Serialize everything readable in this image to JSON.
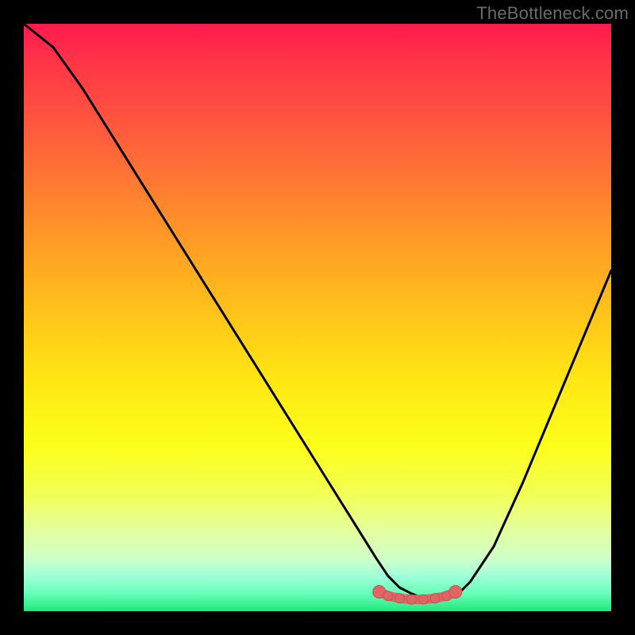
{
  "watermark": "TheBottleneck.com",
  "chart_data": {
    "type": "line",
    "title": "",
    "xlabel": "",
    "ylabel": "",
    "xlim": [
      0,
      100
    ],
    "ylim": [
      0,
      100
    ],
    "grid": false,
    "legend": false,
    "series": [
      {
        "name": "bottleneck-curve",
        "x": [
          0,
          5,
          10,
          15,
          20,
          25,
          30,
          35,
          40,
          45,
          50,
          55,
          60,
          62,
          64,
          66,
          68,
          70,
          72,
          74,
          76,
          80,
          85,
          90,
          95,
          100
        ],
        "y": [
          100,
          96,
          89,
          81,
          73,
          65,
          57,
          49,
          41,
          33,
          25,
          17,
          9,
          6,
          4,
          3,
          2.2,
          2,
          2.2,
          3,
          5,
          11,
          22,
          34,
          46,
          58
        ]
      }
    ],
    "markers": {
      "name": "optimal-range",
      "color": "#e06666",
      "color_dark": "#c94f4f",
      "x": [
        60.5,
        62,
        64,
        66,
        68,
        70,
        72,
        73.5
      ],
      "y": [
        3.3,
        2.6,
        2.2,
        2,
        2,
        2.2,
        2.6,
        3.3
      ]
    },
    "background_gradient": {
      "top": "#ff1a4d",
      "mid": "#ffe514",
      "bottom": "#20e87a"
    }
  }
}
